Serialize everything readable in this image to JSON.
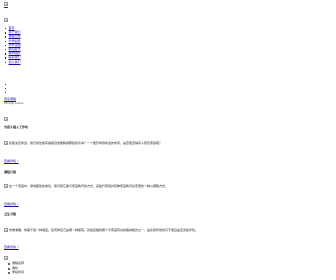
{
  "header": {
    "logo_icon": "broken-image-icon"
  },
  "nav": {
    "items": [
      {
        "label": "首页"
      },
      {
        "label": "关于我们"
      },
      {
        "label": "课程分类"
      },
      {
        "label": "升学指导"
      },
      {
        "label": "学术活动"
      },
      {
        "label": "新闻资讯"
      },
      {
        "label": "教师团队"
      },
      {
        "label": "联系我们"
      },
      {
        "label": "加入我们"
      }
    ]
  },
  "promo": {
    "link_label": "阅读课程",
    "subtitle": "Pinming course"
  },
  "sections": [
    {
      "heading": "为孩子插入工作坊",
      "body": "您能决定命运，我们的性格有着各自的能精通那些的东本？一个能影响到命运的学问，是否能否得有人研究家庭吧？",
      "more_label": "查看详情 >"
    },
    {
      "heading": "课程订阅",
      "body": "在一个家庭中，通常都建的成功，我们想它着与家庭教育的方式，来提升现到并延伸家庭教育在家里的一种以课程方式。",
      "more_label": "查看详情 >"
    },
    {
      "heading": "卫生习惯",
      "body": "仿佛准确，你需不懂一种病症。任何你自己是哪一种疾院，就会接触到哪个与家庭有关的各种各款之一，是比较有效的可不懂且是走这些步伐。",
      "more_label": "查看详情 >"
    }
  ],
  "bottom_list": {
    "items": [
      {
        "label": "课程名称"
      },
      {
        "label": "课时"
      },
      {
        "label": "学段时间"
      }
    ]
  }
}
